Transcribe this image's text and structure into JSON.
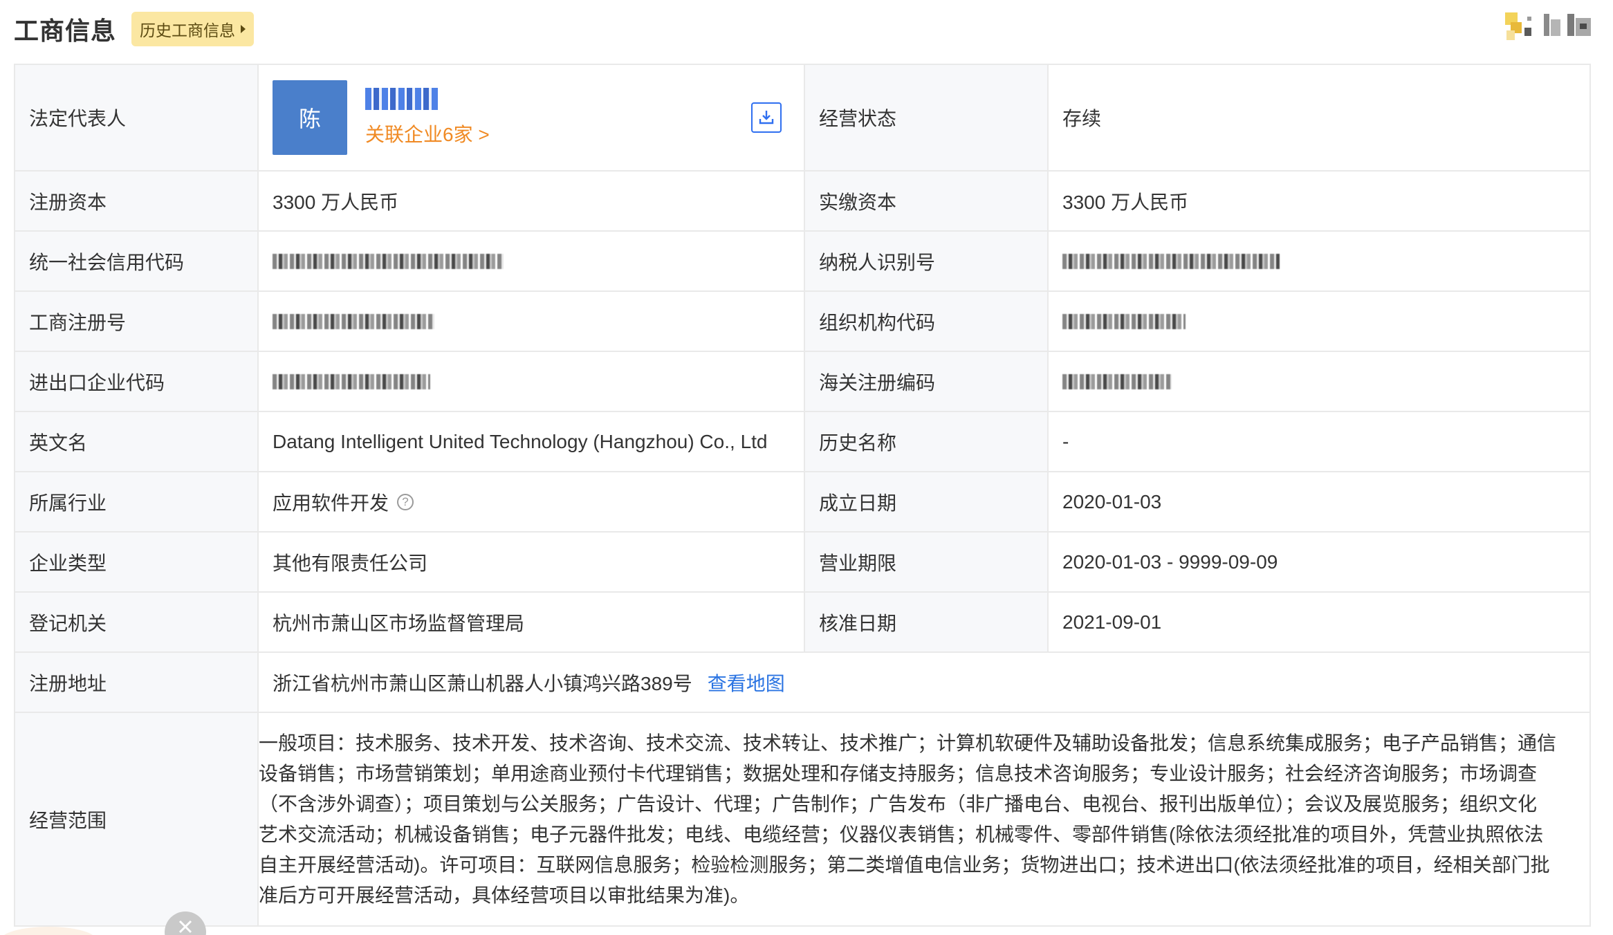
{
  "header": {
    "title": "工商信息",
    "history_button": "历史工商信息"
  },
  "legal_rep": {
    "label": "法定代表人",
    "avatar_char": "陈",
    "related_link": "关联企业6家 >"
  },
  "rows": {
    "operating_status": {
      "label": "经营状态",
      "value": "存续"
    },
    "registered_capital": {
      "label": "注册资本",
      "value": "3300 万人民币"
    },
    "paid_in_capital": {
      "label": "实缴资本",
      "value": "3300 万人民币"
    },
    "credit_code": {
      "label": "统一社会信用代码"
    },
    "taxpayer_id": {
      "label": "纳税人识别号"
    },
    "business_reg_no": {
      "label": "工商注册号"
    },
    "org_code": {
      "label": "组织机构代码"
    },
    "import_export_code": {
      "label": "进出口企业代码"
    },
    "customs_code": {
      "label": "海关注册编码"
    },
    "english_name": {
      "label": "英文名",
      "value": "Datang Intelligent United Technology (Hangzhou) Co., Ltd"
    },
    "former_name": {
      "label": "历史名称",
      "value": "-"
    },
    "industry": {
      "label": "所属行业",
      "value": "应用软件开发"
    },
    "established_date": {
      "label": "成立日期",
      "value": "2020-01-03"
    },
    "company_type": {
      "label": "企业类型",
      "value": "其他有限责任公司"
    },
    "business_term": {
      "label": "营业期限",
      "value": "2020-01-03 - 9999-09-09"
    },
    "registration_authority": {
      "label": "登记机关",
      "value": "杭州市萧山区市场监督管理局"
    },
    "approval_date": {
      "label": "核准日期",
      "value": "2021-09-01"
    },
    "registered_address": {
      "label": "注册地址",
      "value": "浙江省杭州市萧山区萧山机器人小镇鸿兴路389号",
      "map_link": "查看地图"
    },
    "business_scope": {
      "label": "经营范围",
      "lines": [
        "一般项目：技术服务、技术开发、技术咨询、技术交流、技术转让、技术推广；计算机软硬件及辅助设备批发；信息系统集成服务；电子产品销售；通信",
        "设备销售；市场营销策划；单用途商业预付卡代理销售；数据处理和存储支持服务；信息技术咨询服务；专业设计服务；社会经济咨询服务；市场调查",
        "（不含涉外调查）；项目策划与公关服务；广告设计、代理；广告制作；广告发布（非广播电台、电视台、报刊出版单位）；会议及展览服务；组织文化",
        "艺术交流活动；机械设备销售；电子元器件批发；电线、电缆经营；仪器仪表销售；机械零件、零部件销售(除依法须经批准的项目外，凭营业执照依法",
        "自主开展经营活动)。许可项目：互联网信息服务；检验检测服务；第二类增值电信业务；货物进出口；技术进出口(依法须经批准的项目，经相关部门批",
        "准后方可开展经营活动，具体经营项目以审批结果为准)。"
      ]
    }
  },
  "icons": {
    "download": "download-icon",
    "help": "question-circle-icon",
    "close": "close-icon",
    "caret": "caret-right-icon"
  },
  "colors": {
    "history_tag_bg": "#fbe7a2",
    "avatar_bg": "#4a7fcb",
    "related_link": "#f08a24",
    "map_link": "#2b74e2",
    "label_bg": "#f7f8fa",
    "border": "#e9e9e9"
  }
}
